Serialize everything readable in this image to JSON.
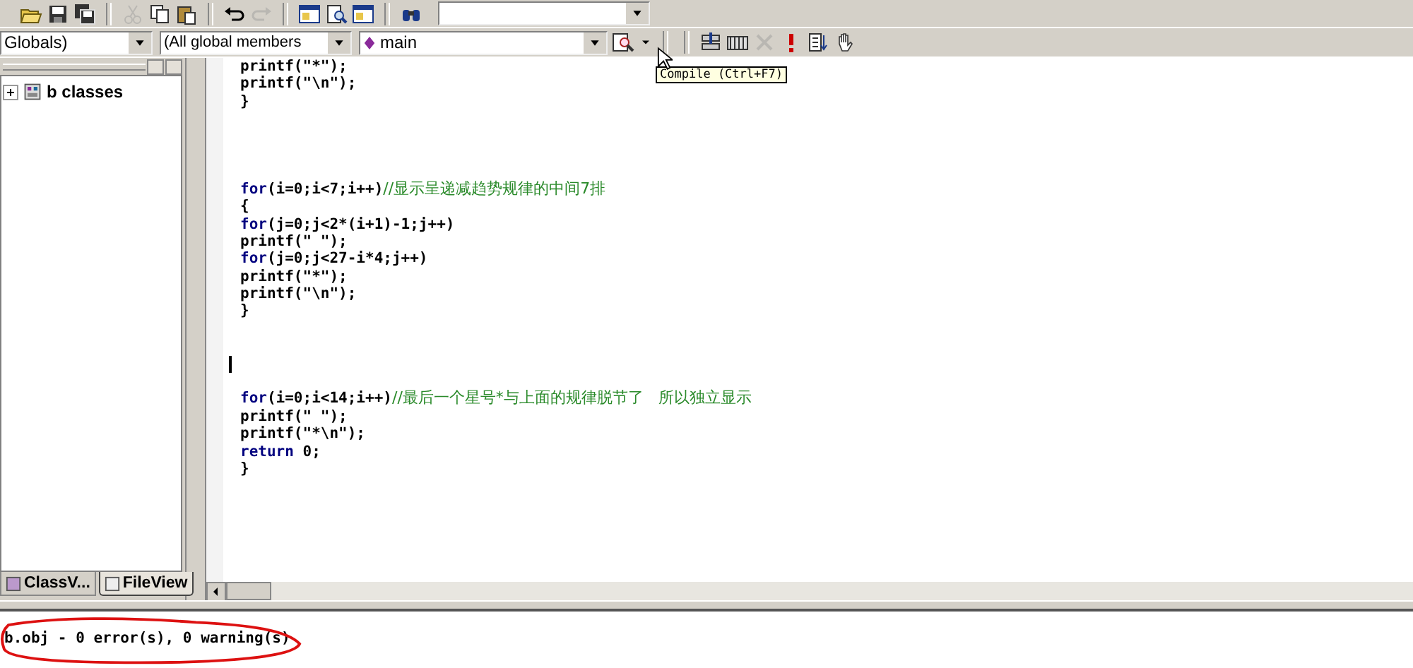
{
  "toolbar": {
    "groups": [
      [
        {
          "kind": "open",
          "disabled": false
        },
        {
          "kind": "save",
          "disabled": false
        },
        {
          "kind": "save-all",
          "disabled": false
        }
      ],
      [
        {
          "kind": "cut",
          "disabled": true
        },
        {
          "kind": "copy",
          "disabled": false
        },
        {
          "kind": "paste",
          "disabled": false
        }
      ],
      [
        {
          "kind": "undo",
          "disabled": false
        },
        {
          "kind": "redo",
          "disabled": true
        }
      ],
      [
        {
          "kind": "workspace",
          "disabled": false
        },
        {
          "kind": "find-files",
          "disabled": false
        },
        {
          "kind": "output",
          "disabled": false
        }
      ],
      [
        {
          "kind": "find",
          "disabled": false
        }
      ]
    ]
  },
  "wizard_bar": {
    "class_combo": "Globals)",
    "filter_combo": "(All global members",
    "function_combo": "main"
  },
  "build_toolbar": [
    {
      "kind": "compile",
      "disabled": false
    },
    {
      "kind": "build",
      "disabled": false
    },
    {
      "kind": "stop",
      "disabled": true
    },
    {
      "kind": "run",
      "disabled": false
    },
    {
      "kind": "breakpoint",
      "disabled": false
    },
    {
      "kind": "hand",
      "disabled": false
    }
  ],
  "tooltip": "Compile (Ctrl+F7)",
  "workspace": {
    "tree": [
      {
        "label": "b classes",
        "expanded": false
      }
    ],
    "tabs": [
      {
        "label": "ClassV...",
        "selected": false
      },
      {
        "label": "FileView",
        "selected": true
      }
    ]
  },
  "editor": {
    "lines": [
      {
        "kind": "code",
        "code": "printf(\"*\");"
      },
      {
        "kind": "code",
        "code": "printf(\"\\n\");"
      },
      {
        "kind": "code",
        "code": "}"
      },
      {
        "kind": "blank"
      },
      {
        "kind": "blank"
      },
      {
        "kind": "blank"
      },
      {
        "kind": "blank"
      },
      {
        "kind": "code",
        "keyword": "for",
        "code": "(i=0;i<7;i++)",
        "comment": "//显示呈递减趋势规律的中间7排"
      },
      {
        "kind": "code",
        "code": "{"
      },
      {
        "kind": "code",
        "keyword": "for",
        "code": "(j=0;j<2*(i+1)-1;j++)"
      },
      {
        "kind": "code",
        "code": "printf(\" \");"
      },
      {
        "kind": "code",
        "keyword": "for",
        "code": "(j=0;j<27-i*4;j++)"
      },
      {
        "kind": "code",
        "code": "printf(\"*\");"
      },
      {
        "kind": "code",
        "code": "printf(\"\\n\");"
      },
      {
        "kind": "code",
        "code": "}"
      },
      {
        "kind": "blank"
      },
      {
        "kind": "blank"
      },
      {
        "kind": "cursor"
      },
      {
        "kind": "blank"
      },
      {
        "kind": "code",
        "keyword": "for",
        "code": "(i=0;i<14;i++)",
        "comment": "//最后一个星号*与上面的规律脱节了   所以独立显示"
      },
      {
        "kind": "code",
        "code": "printf(\" \");"
      },
      {
        "kind": "code",
        "code": "printf(\"*\\n\");"
      },
      {
        "kind": "code",
        "keyword": "return",
        "code": " 0;"
      },
      {
        "kind": "code",
        "code": "}"
      }
    ]
  },
  "output": {
    "lines": [
      "b.obj - 0 error(s), 0 warning(s)"
    ],
    "highlighted": true
  }
}
